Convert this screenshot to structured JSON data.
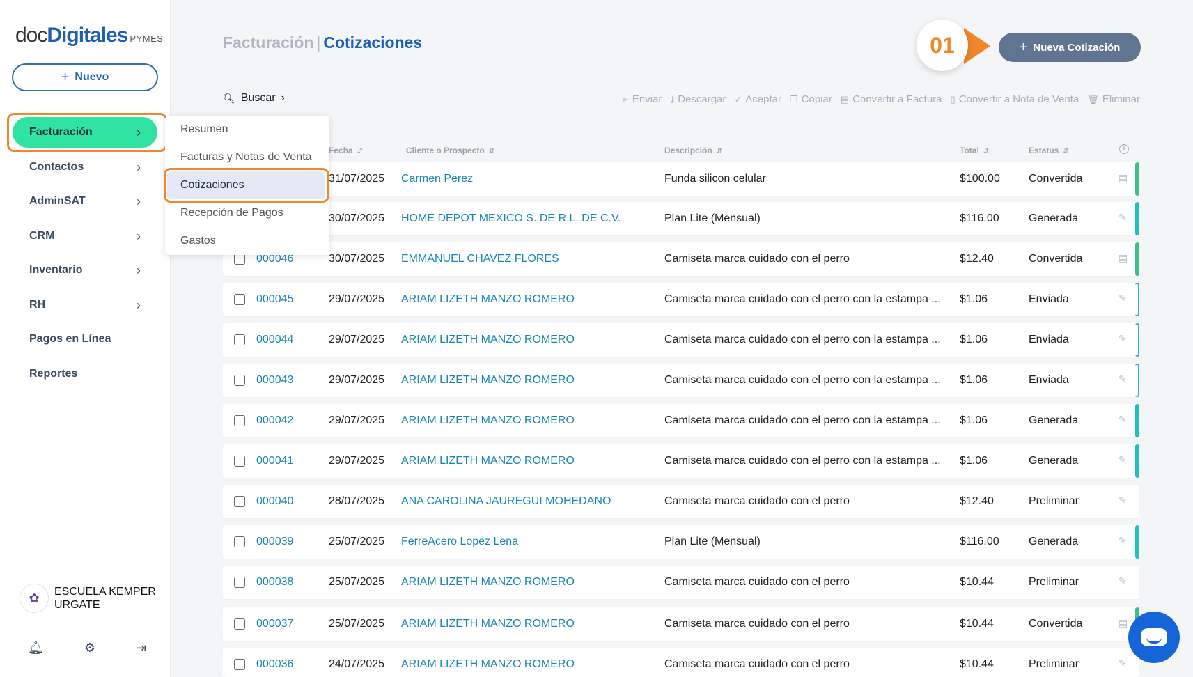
{
  "logo": {
    "doc": "doc",
    "digitales": "Digitales",
    "pymes": "PYMES"
  },
  "sidebar": {
    "new_label": "Nuevo",
    "items": [
      {
        "label": "Facturación"
      },
      {
        "label": "Contactos"
      },
      {
        "label": "AdminSAT"
      },
      {
        "label": "CRM"
      },
      {
        "label": "Inventario"
      },
      {
        "label": "RH"
      },
      {
        "label": "Pagos en Línea"
      },
      {
        "label": "Reportes"
      }
    ],
    "org_name": "ESCUELA KEMPER URGATE"
  },
  "submenu": [
    "Resumen",
    "Facturas y Notas de Venta",
    "Cotizaciones",
    "Recepción de Pagos",
    "Gastos"
  ],
  "header": {
    "section": "Facturación",
    "separator": "|",
    "current": "Cotizaciones",
    "step": "01",
    "new_quote_label": "Nueva Cotización"
  },
  "search_label": "Buscar",
  "toolbar": [
    {
      "icon": "send-icon",
      "label": "Enviar"
    },
    {
      "icon": "download-icon",
      "label": "Descargar"
    },
    {
      "icon": "check-icon",
      "label": "Aceptar"
    },
    {
      "icon": "copy-icon",
      "label": "Copiar"
    },
    {
      "icon": "invoice-icon",
      "label": "Convertir a Factura"
    },
    {
      "icon": "note-icon",
      "label": "Convertir a Nota de Venta"
    },
    {
      "icon": "trash-icon",
      "label": "Eliminar"
    }
  ],
  "table": {
    "columns": {
      "fecha": "Fecha",
      "cliente": "Cliente o Prospecto",
      "descripcion": "Descripción",
      "total": "Total",
      "estatus": "Estatus"
    },
    "rows": [
      {
        "folio": "",
        "fecha": "31/07/2025",
        "cliente": "Carmen Perez",
        "descripcion": "Funda silicon celular",
        "total": "$100.00",
        "estatus": "Convertida"
      },
      {
        "folio": "",
        "fecha": "30/07/2025",
        "cliente": "HOME DEPOT MEXICO S. DE R.L. DE C.V.",
        "descripcion": "Plan Lite (Mensual)",
        "total": "$116.00",
        "estatus": "Generada"
      },
      {
        "folio": "000046",
        "fecha": "30/07/2025",
        "cliente": "EMMANUEL CHAVEZ FLORES",
        "descripcion": "Camiseta marca cuidado con el perro",
        "total": "$12.40",
        "estatus": "Convertida"
      },
      {
        "folio": "000045",
        "fecha": "29/07/2025",
        "cliente": "ARIAM LIZETH MANZO ROMERO",
        "descripcion": "Camiseta marca cuidado con el perro con la estampa ...",
        "total": "$1.06",
        "estatus": "Enviada"
      },
      {
        "folio": "000044",
        "fecha": "29/07/2025",
        "cliente": "ARIAM LIZETH MANZO ROMERO",
        "descripcion": "Camiseta marca cuidado con el perro con la estampa ...",
        "total": "$1.06",
        "estatus": "Enviada"
      },
      {
        "folio": "000043",
        "fecha": "29/07/2025",
        "cliente": "ARIAM LIZETH MANZO ROMERO",
        "descripcion": "Camiseta marca cuidado con el perro con la estampa ...",
        "total": "$1.06",
        "estatus": "Enviada"
      },
      {
        "folio": "000042",
        "fecha": "29/07/2025",
        "cliente": "ARIAM LIZETH MANZO ROMERO",
        "descripcion": "Camiseta marca cuidado con el perro con la estampa ...",
        "total": "$1.06",
        "estatus": "Generada"
      },
      {
        "folio": "000041",
        "fecha": "29/07/2025",
        "cliente": "ARIAM LIZETH MANZO ROMERO",
        "descripcion": "Camiseta marca cuidado con el perro con la estampa ...",
        "total": "$1.06",
        "estatus": "Generada"
      },
      {
        "folio": "000040",
        "fecha": "28/07/2025",
        "cliente": "ANA CAROLINA JAUREGUI MOHEDANO",
        "descripcion": "Camiseta marca cuidado con el perro",
        "total": "$12.40",
        "estatus": "Preliminar"
      },
      {
        "folio": "000039",
        "fecha": "25/07/2025",
        "cliente": "FerreAcero Lopez Lena",
        "descripcion": "Plan Lite (Mensual)",
        "total": "$116.00",
        "estatus": "Generada"
      },
      {
        "folio": "000038",
        "fecha": "25/07/2025",
        "cliente": "ARIAM LIZETH MANZO ROMERO",
        "descripcion": "Camiseta marca cuidado con el perro",
        "total": "$10.44",
        "estatus": "Preliminar"
      },
      {
        "folio": "000037",
        "fecha": "25/07/2025",
        "cliente": "ARIAM LIZETH MANZO ROMERO",
        "descripcion": "Camiseta marca cuidado con el perro",
        "total": "$10.44",
        "estatus": "Convertida"
      },
      {
        "folio": "000036",
        "fecha": "24/07/2025",
        "cliente": "ARIAM LIZETH MANZO ROMERO",
        "descripcion": "Camiseta marca cuidado con el perro",
        "total": "$10.44",
        "estatus": "Preliminar"
      }
    ]
  },
  "colors": {
    "accent": "#1e5fb3",
    "active_nav": "#2fe3a2",
    "highlight": "#f0872a",
    "primary_button": "#5f7591",
    "link": "#1987b3"
  }
}
